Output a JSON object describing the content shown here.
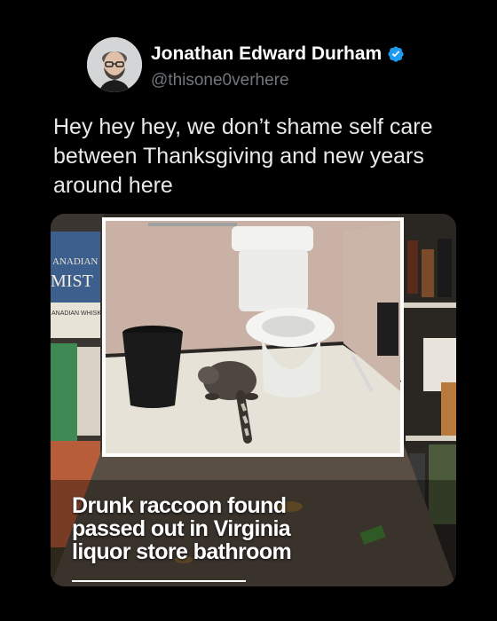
{
  "author": {
    "display_name": "Jonathan Edward Durham",
    "handle": "@thisone0verhere",
    "verified_icon": "verified-badge-icon",
    "verified_color": "#1d9bf0"
  },
  "tweet": {
    "text": "Hey hey hey, we don’t shame self care between Thanksgiving and new years around here"
  },
  "media": {
    "headline_lines": [
      "Drunk raccoon found",
      "passed out in Virginia",
      "liquor store bathroom"
    ],
    "shelf_labels": {
      "brand_top": "ANADIAN",
      "brand_main": "MIST",
      "brand_sub": "ANADIAN WHISKY"
    }
  }
}
